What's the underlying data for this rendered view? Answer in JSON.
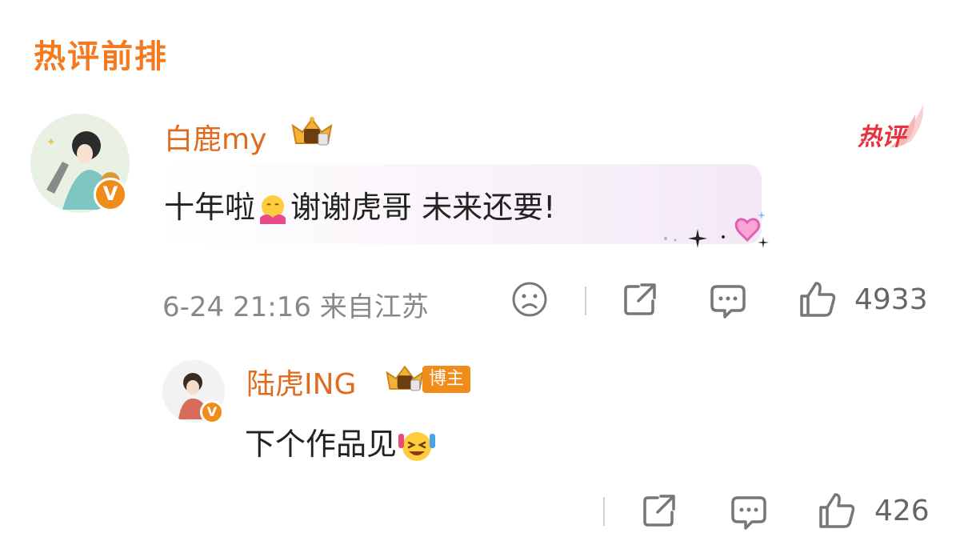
{
  "section": {
    "title": "热评前排"
  },
  "comment": {
    "username": "白鹿my",
    "hot_label": "热评",
    "text_part1": "十年啦",
    "text_part2": "谢谢虎哥 未来还要!",
    "time": "6-24 21:16",
    "location": "来自江苏",
    "likes": "4933",
    "verified_badge": "V"
  },
  "reply": {
    "username": "陆虎ING",
    "role_tag": "博主",
    "text": "下个作品见",
    "likes": "426",
    "verified_badge": "V"
  },
  "colors": {
    "accent": "#f47a22",
    "username": "#e06b1f",
    "hot": "#e8333e"
  }
}
